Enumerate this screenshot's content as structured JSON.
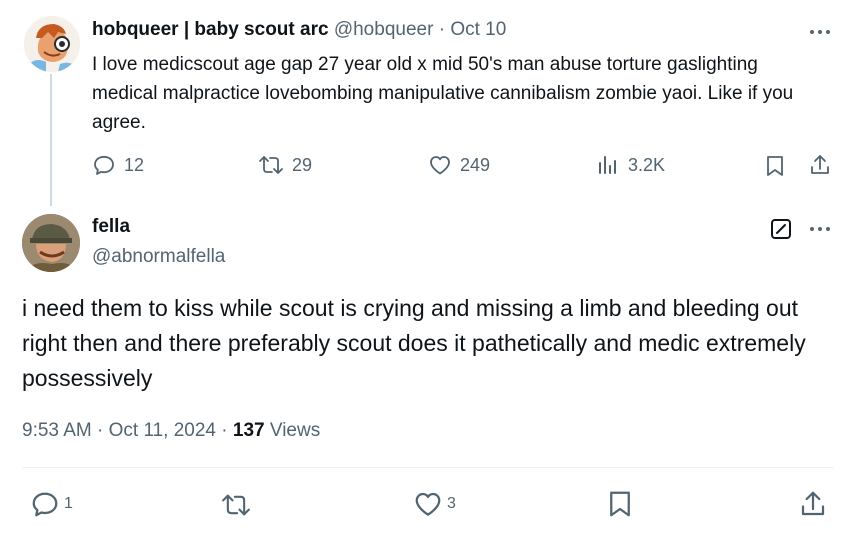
{
  "parent_tweet": {
    "display_name": "hobqueer | baby scout arc",
    "handle": "@hobqueer",
    "separator": "·",
    "date": "Oct 10",
    "text": "I love medicscout age gap 27 year old x mid 50's man abuse torture gaslighting medical malpractice lovebombing manipulative cannibalism zombie yaoi. Like if you agree.",
    "stats": {
      "replies": "12",
      "reposts": "29",
      "likes": "249",
      "views": "3.2K"
    }
  },
  "main_tweet": {
    "display_name": "fella",
    "handle": "@abnormalfella",
    "text": "i need them to kiss while scout is crying and missing a limb and bleeding out right then and there preferably scout does it pathetically and medic extremely possessively",
    "time": "9:53 AM",
    "sep1": "·",
    "date": "Oct 11, 2024",
    "sep2": "·",
    "views_count": "137",
    "views_label": "Views",
    "stats": {
      "replies": "1",
      "likes": "3"
    }
  },
  "colors": {
    "text": "#0f1419",
    "muted": "#536471",
    "divider": "#eff3f4",
    "thread_line": "#cfd9de"
  }
}
